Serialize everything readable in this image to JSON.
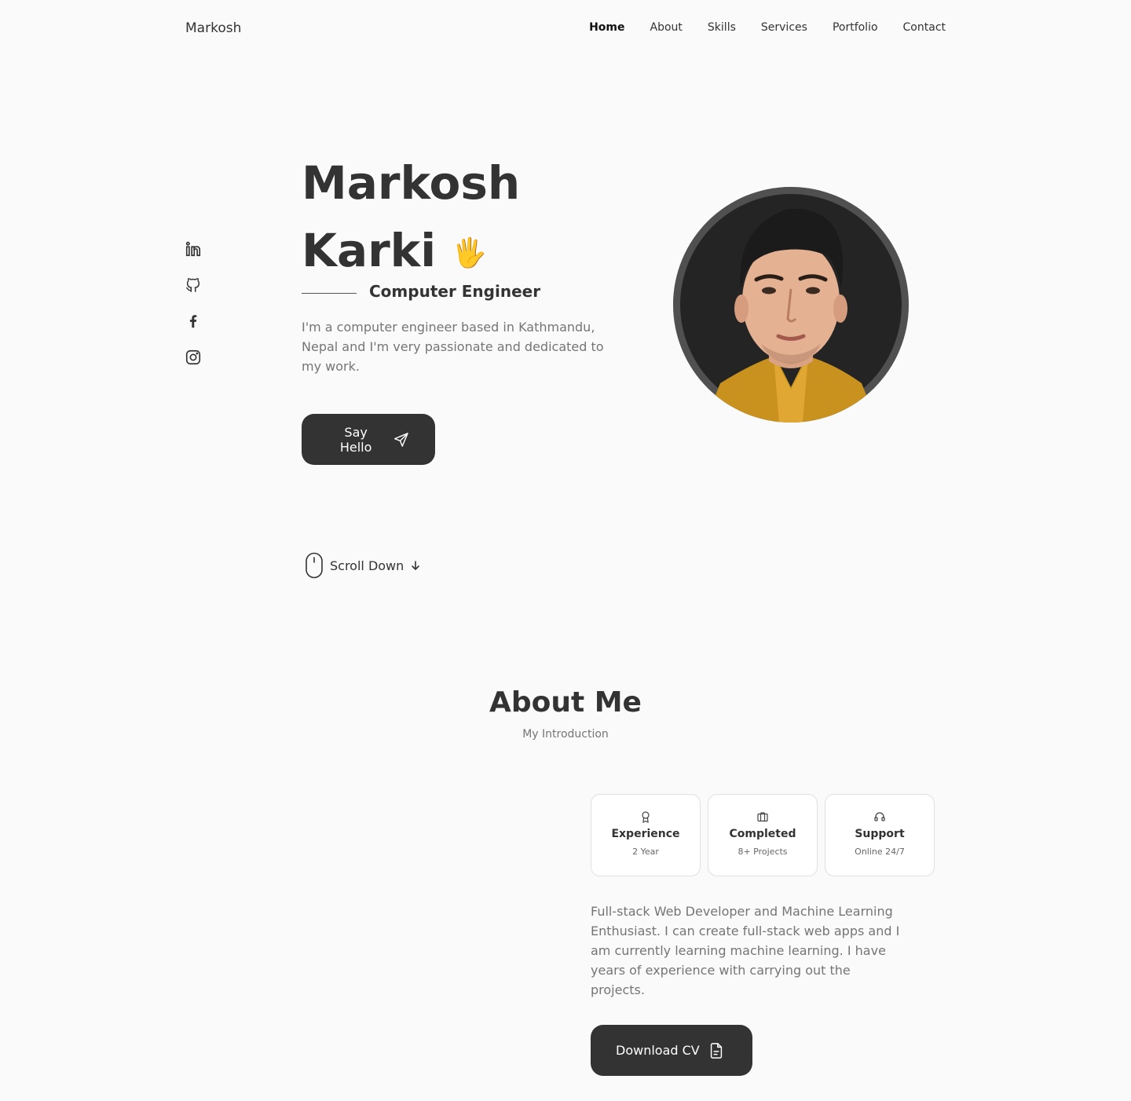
{
  "header": {
    "logo": "Markosh",
    "nav": [
      {
        "label": "Home",
        "active": true
      },
      {
        "label": "About"
      },
      {
        "label": "Skills"
      },
      {
        "label": "Services"
      },
      {
        "label": "Portfolio"
      },
      {
        "label": "Contact"
      }
    ]
  },
  "socials": [
    {
      "icon": "linkedin-icon"
    },
    {
      "icon": "github-icon"
    },
    {
      "icon": "facebook-icon"
    },
    {
      "icon": "instagram-icon"
    }
  ],
  "hero": {
    "first_name": "Markosh",
    "last_name": "Karki",
    "wave": "🖐",
    "subtitle": "Computer Engineer",
    "description": "I'm a computer engineer based in Kathmandu, Nepal and I'm very passionate and dedicated to my work.",
    "button_label": "Say Hello",
    "button_icon": "send-icon",
    "scroll_label": "Scroll Down"
  },
  "about": {
    "title": "About Me",
    "subtitle": "My Introduction",
    "cards": [
      {
        "icon": "award-icon",
        "title": "Experience",
        "value": "2 Year"
      },
      {
        "icon": "briefcase-icon",
        "title": "Completed",
        "value": "8+ Projects"
      },
      {
        "icon": "headset-icon",
        "title": "Support",
        "value": "Online 24/7"
      }
    ],
    "description": "Full-stack Web Developer and Machine Learning Enthusiast. I can create full-stack web apps and I am currently learning machine learning. I have years of experience with carrying out the projects.",
    "button_label": "Download CV",
    "button_icon": "file-icon"
  },
  "colors": {
    "background": "#fafafa",
    "primary": "#333333",
    "muted": "#757575"
  }
}
